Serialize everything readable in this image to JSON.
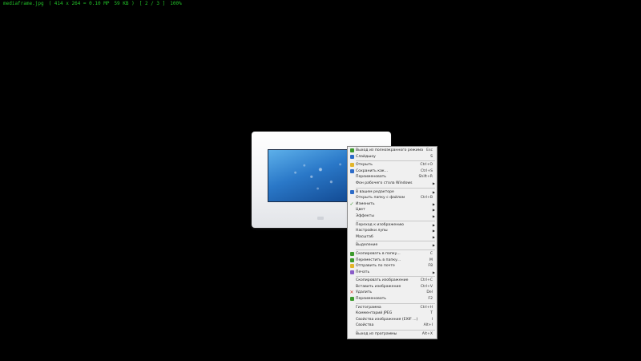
{
  "status": {
    "filename": "mediaframe.jpg",
    "dimensions": "( 414 x 264 = 0.10 MP",
    "filesize": "59 KB )",
    "pages": "[ 2 / 3 ]",
    "zoom": "100%"
  },
  "menu": {
    "fullscreen": {
      "label": "Выход из полноэкранного режима",
      "shortcut": "Esc"
    },
    "slideshow": {
      "label": "Слайдшоу",
      "shortcut": "S"
    },
    "open": {
      "label": "Открыть",
      "shortcut": "Ctrl+O"
    },
    "save_as": {
      "label": "Сохранить как...",
      "shortcut": "Ctrl+S"
    },
    "rename": {
      "label": "Переименовать",
      "shortcut": "Shift+R"
    },
    "wallpaper": {
      "label": "Фон рабочего стола Windows"
    },
    "external_editor": {
      "label": "В вашем редакторе"
    },
    "open_folder": {
      "label": "Открыть папку с файлом",
      "shortcut": "Ctrl+B"
    },
    "modify": {
      "label": "Изменить"
    },
    "color": {
      "label": "Цвет"
    },
    "effects": {
      "label": "Эффекты"
    },
    "goto_image": {
      "label": "Переход к изображению"
    },
    "zoom_settings": {
      "label": "Настройки лупы"
    },
    "scale": {
      "label": "Масштаб"
    },
    "selection": {
      "label": "Выделение"
    },
    "copy_to_folder": {
      "label": "Скопировать в папку...",
      "shortcut": "C"
    },
    "move_to_folder": {
      "label": "Переместить в папку...",
      "shortcut": "M"
    },
    "send_email": {
      "label": "Отправить по почте",
      "shortcut": "F8"
    },
    "print": {
      "label": "Печать"
    },
    "copy_image": {
      "label": "Скопировать изображение",
      "shortcut": "Ctrl+C"
    },
    "paste_image": {
      "label": "Вставить изображение",
      "shortcut": "Ctrl+V"
    },
    "delete": {
      "label": "Удалить",
      "shortcut": "Del"
    },
    "rename2": {
      "label": "Переименовать",
      "shortcut": "F2"
    },
    "histogram": {
      "label": "Гистограмма",
      "shortcut": "Ctrl+H"
    },
    "jpeg_comment": {
      "label": "Комментарий JPEG",
      "shortcut": "T"
    },
    "exif": {
      "label": "Свойства изображения (EXIF ...)",
      "shortcut": "I"
    },
    "properties": {
      "label": "Свойства",
      "shortcut": "Alt+I"
    },
    "exit": {
      "label": "Выход из программы",
      "shortcut": "Alt+X"
    }
  },
  "colors": {
    "status_text": "#22c028",
    "menu_bg": "#f0f0f0",
    "icon_green": "#3c9a2c",
    "icon_yellow": "#e2b52a",
    "icon_red": "#d23a2a",
    "icon_blue": "#2c6bc8"
  }
}
